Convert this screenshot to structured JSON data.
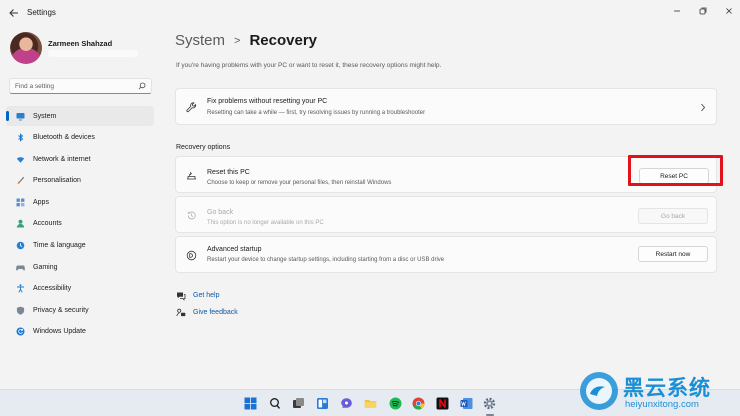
{
  "app": {
    "title": "Settings"
  },
  "user": {
    "name": "Zarmeen Shahzad"
  },
  "search": {
    "placeholder": "Find a setting"
  },
  "sidebar": {
    "items": [
      {
        "label": "System",
        "icon": "monitor-icon",
        "active": true
      },
      {
        "label": "Bluetooth & devices",
        "icon": "bluetooth-icon"
      },
      {
        "label": "Network & internet",
        "icon": "wifi-icon"
      },
      {
        "label": "Personalisation",
        "icon": "brush-icon"
      },
      {
        "label": "Apps",
        "icon": "apps-icon"
      },
      {
        "label": "Accounts",
        "icon": "account-icon"
      },
      {
        "label": "Time & language",
        "icon": "globe-clock-icon"
      },
      {
        "label": "Gaming",
        "icon": "gamepad-icon"
      },
      {
        "label": "Accessibility",
        "icon": "accessibility-icon"
      },
      {
        "label": "Privacy & security",
        "icon": "shield-icon"
      },
      {
        "label": "Windows Update",
        "icon": "update-icon"
      }
    ]
  },
  "breadcrumb": {
    "parent": "System",
    "separator": ">",
    "current": "Recovery"
  },
  "main": {
    "intro": "If you're having problems with your PC or want to reset it, these recovery options might help.",
    "fix_card": {
      "title": "Fix problems without resetting your PC",
      "desc": "Resetting can take a while — first, try resolving issues by running a troubleshooter"
    },
    "section_label": "Recovery options",
    "options": [
      {
        "title": "Reset this PC",
        "desc": "Choose to keep or remove your personal files, then reinstall Windows",
        "button": "Reset PC",
        "enabled": true
      },
      {
        "title": "Go back",
        "desc": "This option is no longer available on this PC",
        "button": "Go back",
        "enabled": false
      },
      {
        "title": "Advanced startup",
        "desc": "Restart your device to change startup settings, including starting from a disc or USB drive",
        "button": "Restart now",
        "enabled": true
      }
    ],
    "links": {
      "help": "Get help",
      "feedback": "Give feedback"
    }
  },
  "colors": {
    "accent": "#0067c0",
    "highlight": "#e0121c",
    "link": "#0a5aa8"
  },
  "watermark": {
    "brand": "黑云系统",
    "url": "heiyunxitong.com"
  }
}
